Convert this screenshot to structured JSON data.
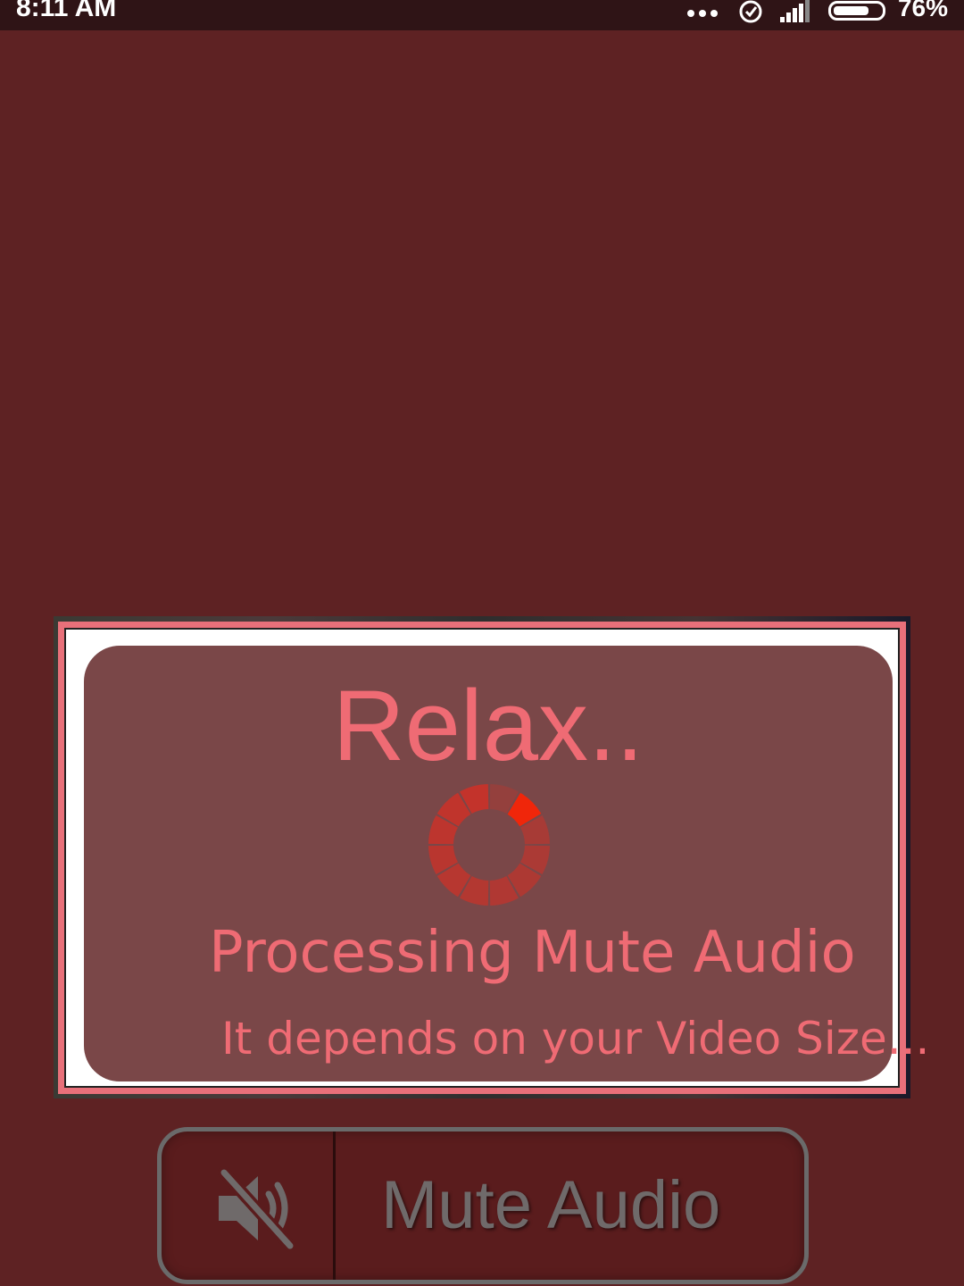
{
  "status_bar": {
    "time": "8:11 AM",
    "battery_percent": "76%",
    "battery_level": 0.76,
    "icons": [
      "more-dots-icon",
      "alarm-icon",
      "signal-icon",
      "battery-icon"
    ]
  },
  "dialog": {
    "title": "Relax..",
    "message": "Processing Mute Audio",
    "submessage": "It depends on your Video Size...",
    "spinner_icon": "loading-spinner-icon"
  },
  "mute_button": {
    "label": "Mute Audio",
    "icon": "volume-mute-icon"
  },
  "colors": {
    "background": "#5e2223",
    "status_bar": "#2f1416",
    "dialog_border": "#e8707a",
    "dialog_panel": "#7a4748",
    "accent_text": "#ef6b74",
    "spinner_active": "#f0260a",
    "spinner_inactive": "#c7332a"
  }
}
